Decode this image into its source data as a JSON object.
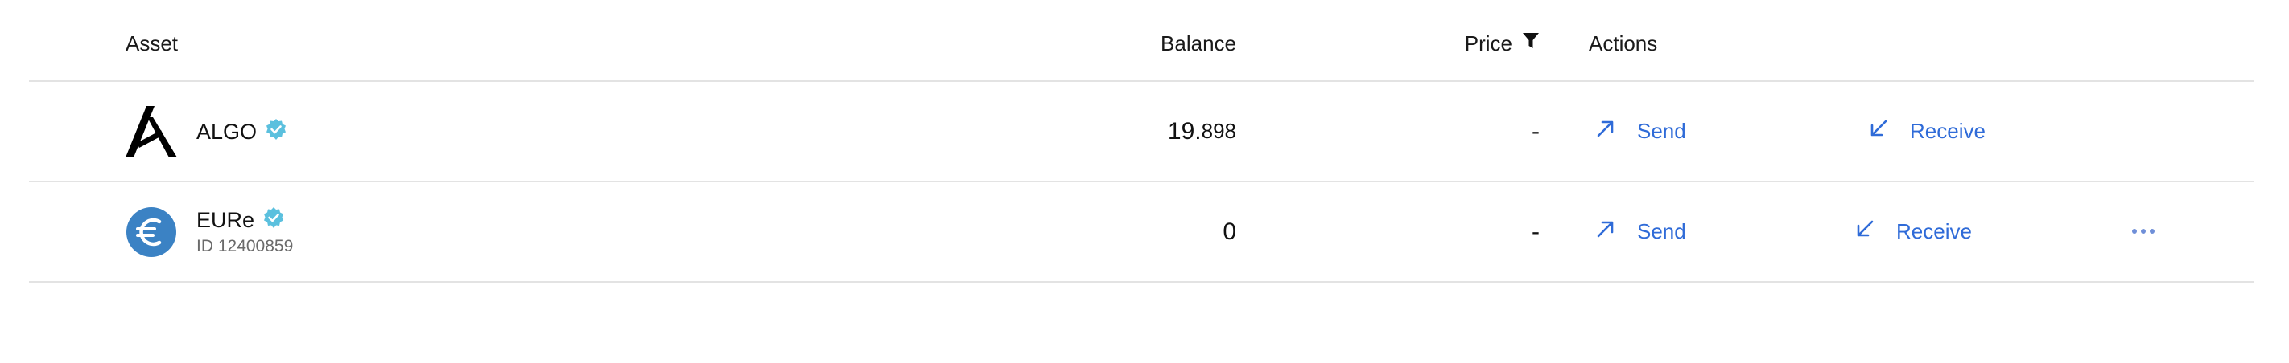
{
  "header": {
    "asset": "Asset",
    "balance": "Balance",
    "price": "Price",
    "actions": "Actions"
  },
  "rows": [
    {
      "name": "ALGO",
      "id": "",
      "verified": true,
      "icon": "algorand-logo-icon",
      "balance_main": "19.",
      "balance_fraction": "898",
      "price": "-",
      "send": "Send",
      "receive": "Receive"
    },
    {
      "name": "EURe",
      "id": "ID 12400859",
      "verified": true,
      "icon": "euro-logo-icon",
      "balance": "0",
      "price": "-",
      "send": "Send",
      "receive": "Receive",
      "more": "more-options-icon"
    }
  ],
  "colors": {
    "accent": "#2f6bd8",
    "verified": "#5bc0de",
    "euro_logo": "#3b82c4",
    "border": "#e3e3e3"
  }
}
